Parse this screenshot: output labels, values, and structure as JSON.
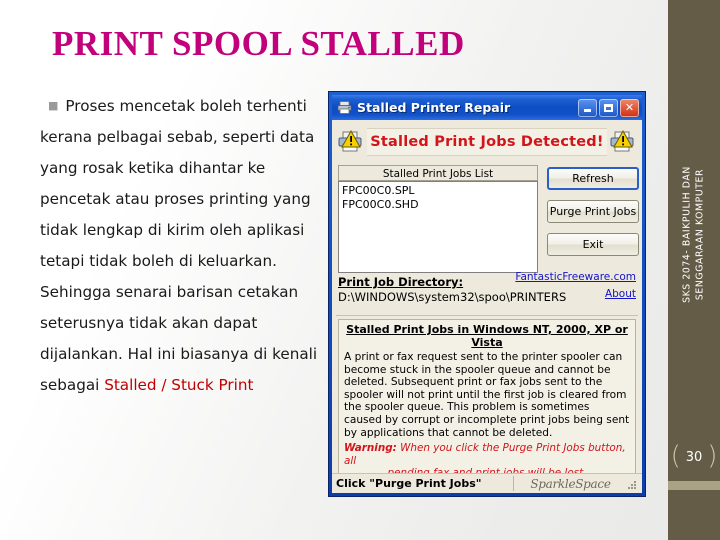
{
  "slide": {
    "title": "PRINT SPOOL STALLED",
    "body_before": "Proses mencetak boleh terhenti kerana pelbagai sebab, seperti data yang rosak ketika dihantar ke pencetak atau proses printing yang tidak lengkap di kirim oleh aplikasi tetapi tidak boleh di keluarkan. Sehingga senarai barisan cetakan seterusnya tidak akan dapat dijalankan. Hal ini biasanya di kenali sebagai ",
    "body_highlight": "Stalled / Stuck Print",
    "title_color": "#C2007B",
    "highlight_color": "#C00000"
  },
  "sidebar": {
    "vertical_text": "SKS 2074- BAIKPULIH DAN\nSENGGARAAN KOMPUTER",
    "page_number": "30",
    "bracket_left": "(",
    "bracket_right": ")",
    "background_color": "#645C46",
    "band_color": "#A9A383"
  },
  "window": {
    "title": "Stalled Printer Repair",
    "icon": "printer-icon",
    "minimize_label": "",
    "maximize_label": "",
    "close_label": "✕",
    "alert_text": "Stalled Print Jobs Detected!",
    "alert_color": "#D2151A",
    "list_header": "Stalled Print Jobs List",
    "list_items": [
      "FPC00C0.SPL",
      "FPC00C0.SHD"
    ],
    "buttons": [
      {
        "label": "Refresh",
        "focused": true
      },
      {
        "label": "Purge Print Jobs",
        "focused": false
      },
      {
        "label": "Exit",
        "focused": false
      }
    ],
    "directory_label": "Print Job Directory:",
    "directory_value": "D:\\WINDOWS\\system32\\spoo\\PRINTERS",
    "links": [
      {
        "label": "FantasticFreeware.com"
      },
      {
        "label": "About"
      }
    ],
    "link_color": "#1414C8",
    "info_title": "Stalled Print Jobs in Windows NT, 2000, XP or Vista",
    "info_body": "A print or fax request sent to the printer spooler can become stuck in the spooler queue and cannot be deleted. Subsequent print or fax jobs sent to the spooler will not print until the first job is cleared from the spooler queue. This problem is sometimes caused by corrupt or incomplete print jobs being sent by applications that cannot be deleted.",
    "warning_label": "Warning:",
    "warning_line1": " When you click the Purge Print Jobs button, all",
    "warning_line2": "pending fax and print jobs will be lost.",
    "status_text": "Click \"Purge Print Jobs\" Button to Fix",
    "status_logo": "SparkleSpace"
  }
}
